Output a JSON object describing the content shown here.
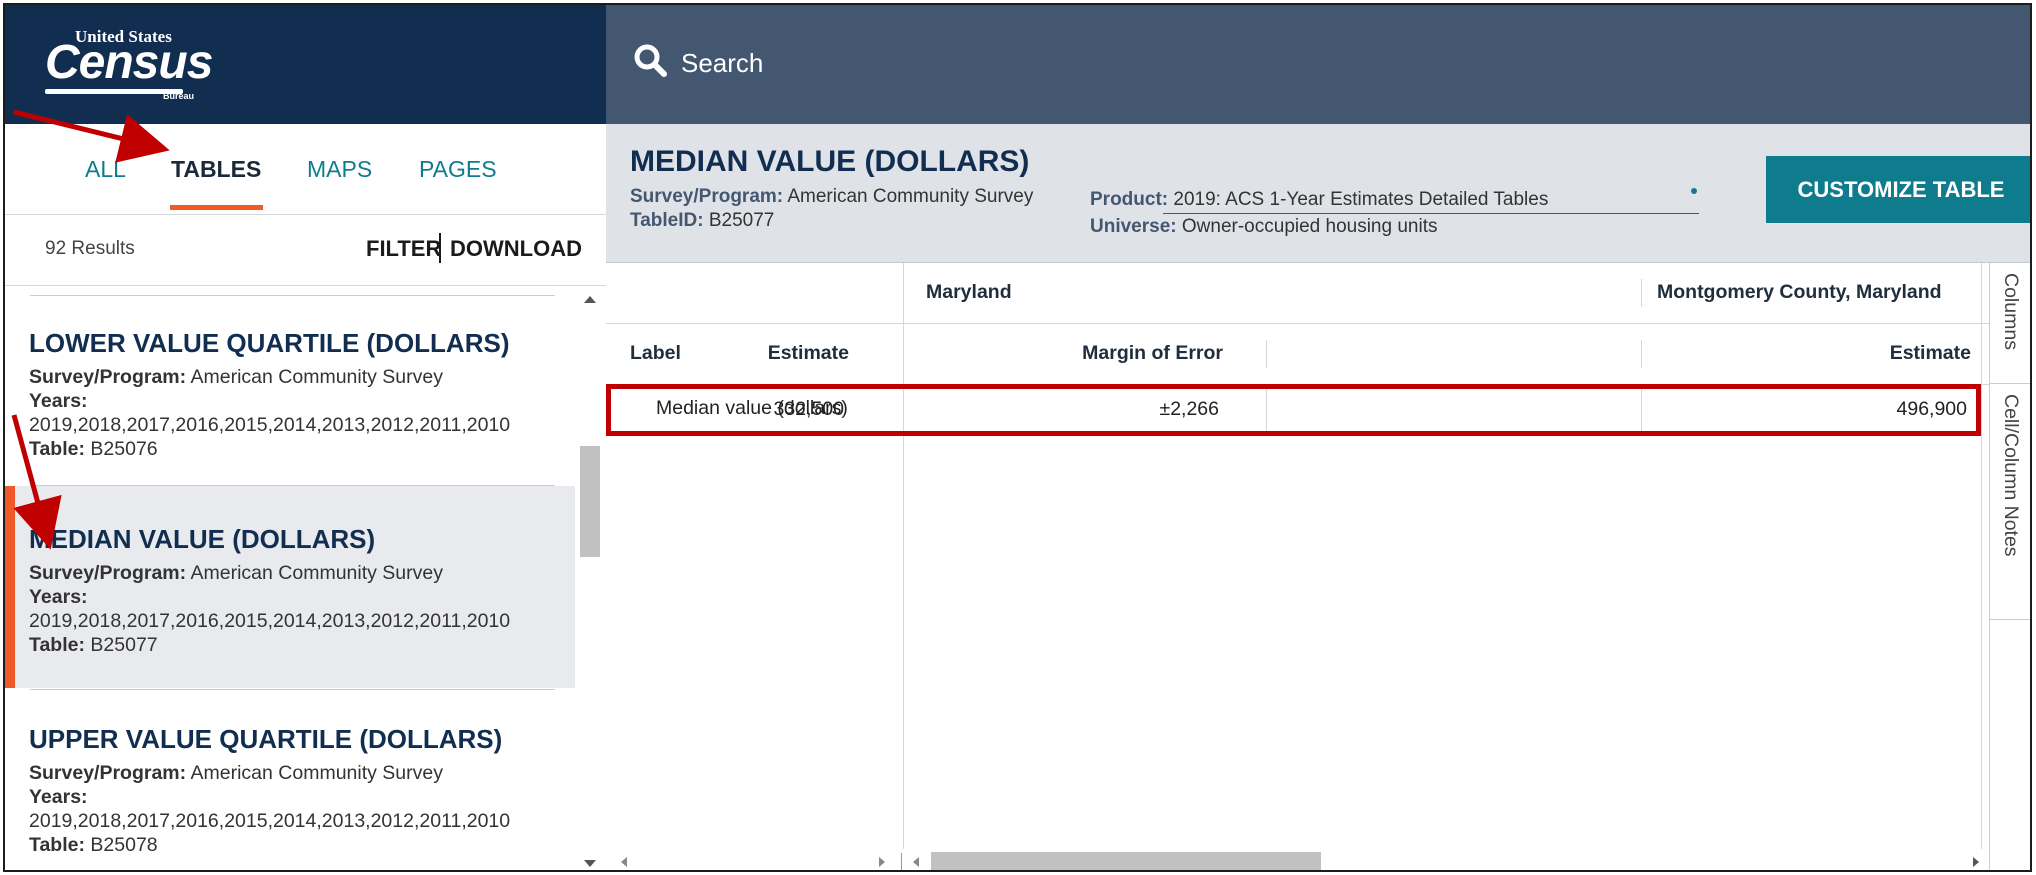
{
  "logo": {
    "line1": "United States",
    "line2": "Census",
    "line3": "Bureau"
  },
  "search": {
    "label": "Search"
  },
  "tabs": [
    {
      "label": "ALL"
    },
    {
      "label": "TABLES"
    },
    {
      "label": "MAPS"
    },
    {
      "label": "PAGES"
    }
  ],
  "results": {
    "count": "92 Results",
    "filter": "FILTER",
    "download": "DOWNLOAD"
  },
  "list": [
    {
      "title": "LOWER VALUE QUARTILE (DOLLARS)",
      "program_label": "Survey/Program:",
      "program": "American Community Survey",
      "years_label": "Years:",
      "years": "2019,2018,2017,2016,2015,2014,2013,2012,2011,2010",
      "table_label": "Table:",
      "table": "B25076"
    },
    {
      "title": "MEDIAN VALUE (DOLLARS)",
      "program_label": "Survey/Program:",
      "program": "American Community Survey",
      "years_label": "Years:",
      "years": "2019,2018,2017,2016,2015,2014,2013,2012,2011,2010",
      "table_label": "Table:",
      "table": "B25077"
    },
    {
      "title": "UPPER VALUE QUARTILE (DOLLARS)",
      "program_label": "Survey/Program:",
      "program": "American Community Survey",
      "years_label": "Years:",
      "years": "2019,2018,2017,2016,2015,2014,2013,2012,2011,2010",
      "table_label": "Table:",
      "table": "B25078"
    }
  ],
  "table_info": {
    "title": "MEDIAN VALUE (DOLLARS)",
    "program_label": "Survey/Program:",
    "program": "American Community Survey",
    "tableid_label": "TableID:",
    "tableid": "B25077",
    "product_label": "Product:",
    "product": "2019: ACS 1-Year Estimates Detailed Tables",
    "universe_label": "Universe:",
    "universe": "Owner-occupied housing units",
    "customize_label": "CUSTOMIZE TABLE"
  },
  "grid": {
    "geo_headers": [
      "Maryland",
      "Montgomery County, Maryland"
    ],
    "col_headers": {
      "label": "Label",
      "estimate": "Estimate",
      "moe": "Margin of Error",
      "estimate2": "Estimate"
    },
    "row": {
      "label": "Median value (dollars)",
      "md_estimate": "332,500",
      "md_moe": "±2,266",
      "mc_estimate": "496,900"
    }
  },
  "side_tabs": [
    "Columns",
    "Cell/Column Notes"
  ],
  "colors": {
    "header": "#112e51",
    "search_bar": "#445771",
    "accent": "#f05a28",
    "teal": "#0f7c8d",
    "highlight": "#c00000"
  }
}
